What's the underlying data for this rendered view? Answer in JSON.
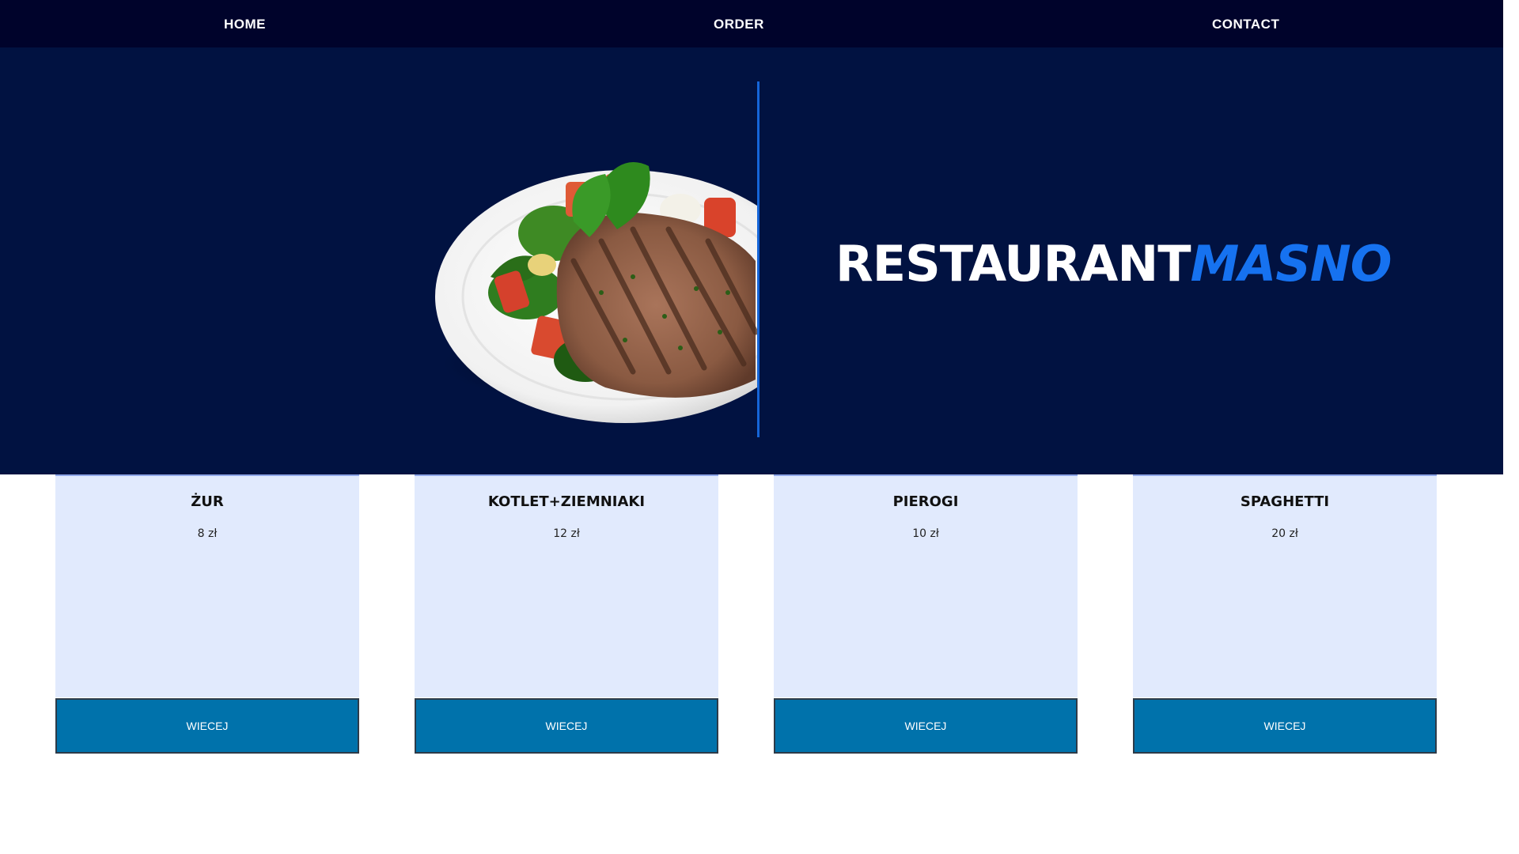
{
  "nav": {
    "items": [
      {
        "label": "HOME"
      },
      {
        "label": "ORDER"
      },
      {
        "label": "CONTACT"
      }
    ]
  },
  "hero": {
    "brand_part1": "RESTAURANT",
    "brand_part2": "MASNO",
    "image_alt": "plate with grilled pork chop and salad"
  },
  "menu": {
    "items": [
      {
        "name": "ŻUR",
        "price": "8 zł",
        "button": "WIECEJ"
      },
      {
        "name": "KOTLET+ZIEMNIAKI",
        "price": "12 zł",
        "button": "WIECEJ"
      },
      {
        "name": "PIEROGI",
        "price": "10 zł",
        "button": "WIECEJ"
      },
      {
        "name": "SPAGHETTI",
        "price": "20 zł",
        "button": "WIECEJ"
      }
    ]
  },
  "colors": {
    "nav_bg": "#00032b",
    "hero_bg": "#011241",
    "accent": "#1672f0",
    "card_bg": "#e1eafd",
    "button_bg": "#0072ab"
  }
}
